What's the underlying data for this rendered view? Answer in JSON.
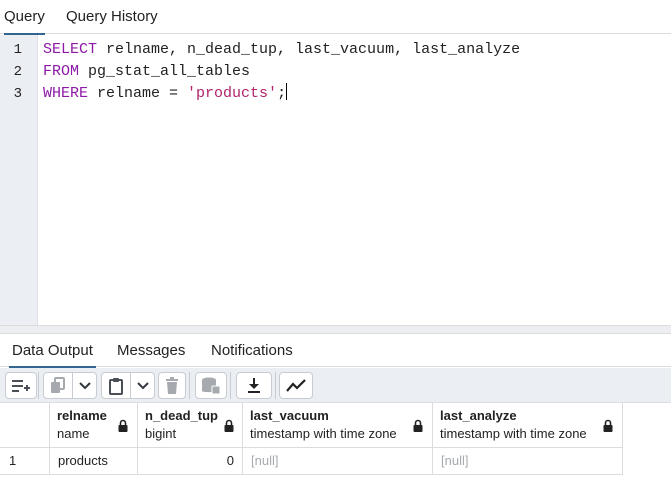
{
  "top_tabs": [
    {
      "label": "Query",
      "active": true
    },
    {
      "label": "Query History",
      "active": false
    }
  ],
  "editor": {
    "line_numbers": [
      "1",
      "2",
      "3"
    ],
    "lines": [
      [
        {
          "t": "SELECT",
          "kind": "kw"
        },
        {
          "t": " relname, n_dead_tup, last_vacuum, last_analyze",
          "kind": "plain"
        }
      ],
      [
        {
          "t": "FROM",
          "kind": "kw"
        },
        {
          "t": " pg_stat_all_tables",
          "kind": "plain"
        }
      ],
      [
        {
          "t": "WHERE",
          "kind": "kw"
        },
        {
          "t": " relname = ",
          "kind": "plain"
        },
        {
          "t": "'products'",
          "kind": "str"
        },
        {
          "t": ";",
          "kind": "plain"
        }
      ]
    ],
    "colors": {
      "keyword": "#8c1aa6",
      "string": "#b2236a",
      "plain": "#222222"
    }
  },
  "bottom_tabs": [
    {
      "label": "Data Output",
      "active": true
    },
    {
      "label": "Messages",
      "active": false
    },
    {
      "label": "Notifications",
      "active": false
    }
  ],
  "toolbar": {
    "buttons": [
      {
        "name": "add-row-button",
        "icon": "add-row-icon"
      },
      {
        "name": "copy-button",
        "icon": "copy-icon"
      },
      {
        "name": "copy-options-dropdown",
        "icon": "chevron-down-icon"
      },
      {
        "name": "paste-button",
        "icon": "paste-icon"
      },
      {
        "name": "paste-options-dropdown",
        "icon": "chevron-down-icon"
      },
      {
        "name": "delete-button",
        "icon": "trash-icon"
      },
      {
        "name": "save-data-button",
        "icon": "database-save-icon"
      },
      {
        "name": "download-button",
        "icon": "download-icon"
      },
      {
        "name": "graph-visualiser-button",
        "icon": "line-chart-icon"
      }
    ]
  },
  "grid": {
    "columns": [
      {
        "name": "relname",
        "type": "name"
      },
      {
        "name": "n_dead_tup",
        "type": "bigint"
      },
      {
        "name": "last_vacuum",
        "type": "timestamp with time zone"
      },
      {
        "name": "last_analyze",
        "type": "timestamp with time zone"
      }
    ],
    "rows": [
      {
        "row_number": "1",
        "cells": [
          "products",
          "0",
          "[null]",
          "[null]"
        ]
      }
    ]
  },
  "accent_color": "#326690"
}
